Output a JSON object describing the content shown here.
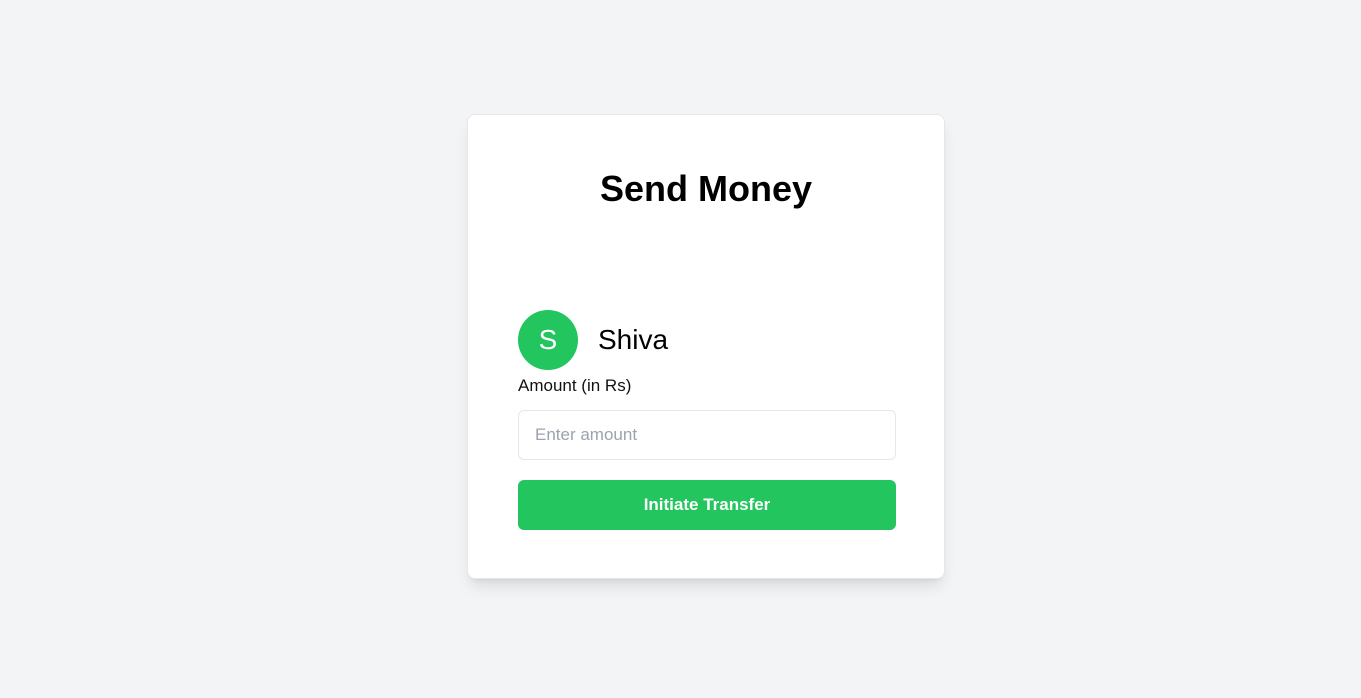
{
  "page": {
    "title": "Send Money"
  },
  "recipient": {
    "avatar_initial": "S",
    "name": "Shiva"
  },
  "amount": {
    "label": "Amount (in Rs)",
    "value": "",
    "placeholder": "Enter amount"
  },
  "actions": {
    "transfer_label": "Initiate Transfer"
  },
  "colors": {
    "background": "#f3f4f6",
    "card": "#ffffff",
    "accent_green": "#22c55e",
    "placeholder_gray": "#9ca3af"
  }
}
